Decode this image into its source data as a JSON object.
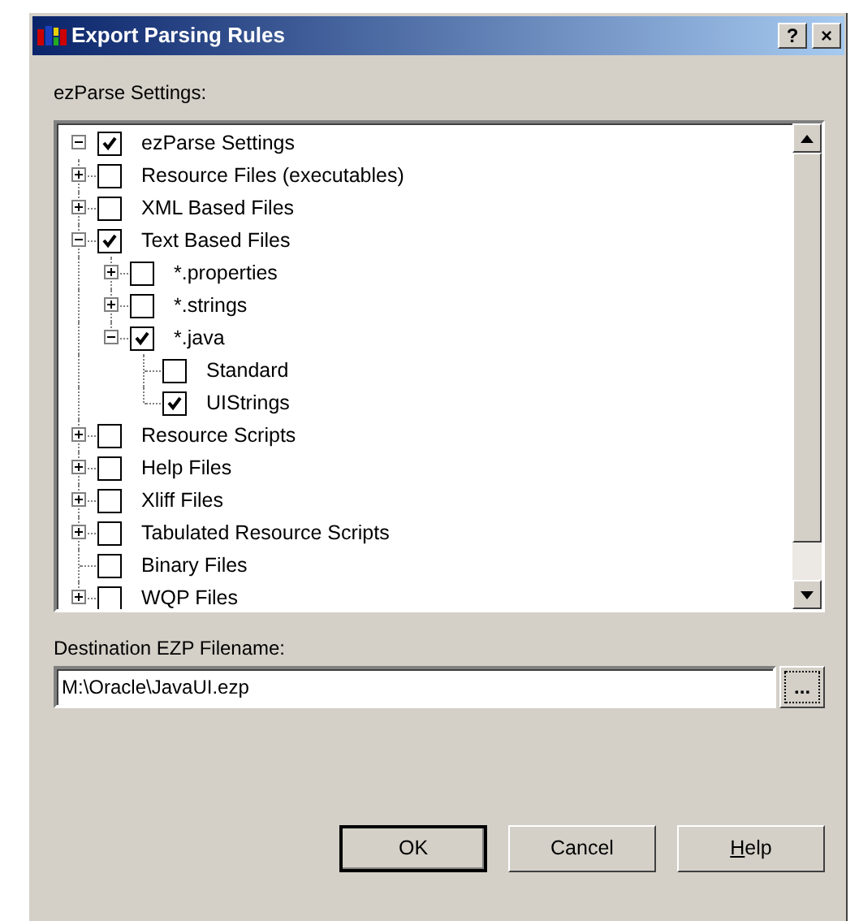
{
  "window": {
    "title": "Export Parsing Rules",
    "title_buttons": [
      "?",
      "×"
    ]
  },
  "settings_label": "ezParse Settings:",
  "tree": {
    "items": [
      {
        "label": "ezParse Settings",
        "checked": true,
        "expanded": true,
        "children": [
          {
            "label": "Resource Files (executables)",
            "checked": false,
            "expanded": false
          },
          {
            "label": "XML Based Files",
            "checked": false,
            "expanded": false
          },
          {
            "label": "Text Based Files",
            "checked": true,
            "expanded": true,
            "children": [
              {
                "label": "*.properties",
                "checked": false,
                "expanded": false
              },
              {
                "label": "*.strings",
                "checked": false,
                "expanded": false
              },
              {
                "label": "*.java",
                "checked": true,
                "expanded": true,
                "children": [
                  {
                    "label": "Standard",
                    "checked": false
                  },
                  {
                    "label": "UIStrings",
                    "checked": true
                  }
                ]
              }
            ]
          },
          {
            "label": "Resource Scripts",
            "checked": false,
            "expanded": false
          },
          {
            "label": "Help Files",
            "checked": false,
            "expanded": false
          },
          {
            "label": "Xliff Files",
            "checked": false,
            "expanded": false
          },
          {
            "label": "Tabulated Resource Scripts",
            "checked": false,
            "expanded": false
          },
          {
            "label": "Binary Files",
            "checked": false
          },
          {
            "label": "WQP Files",
            "checked": false,
            "expanded": false
          }
        ]
      }
    ]
  },
  "destination": {
    "label": "Destination EZP Filename:",
    "value": "M:\\Oracle\\JavaUI.ezp",
    "browse": "..."
  },
  "buttons": [
    {
      "label": "OK",
      "default": true,
      "mnemonic": false
    },
    {
      "label": "Cancel",
      "default": false,
      "mnemonic": false
    },
    {
      "label": "Help",
      "default": false,
      "mnemonic": true
    }
  ]
}
